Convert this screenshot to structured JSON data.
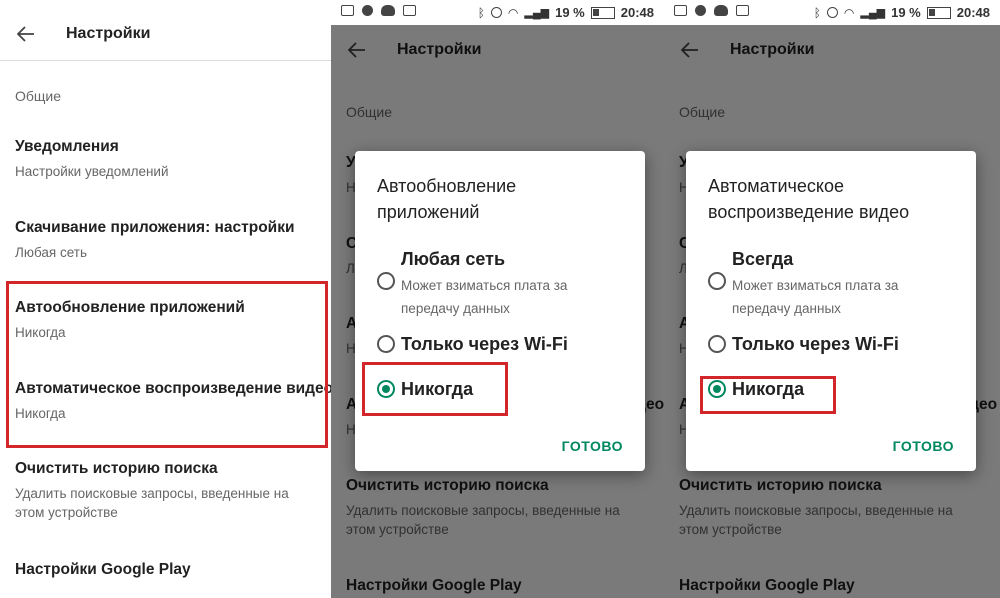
{
  "status_bar": {
    "battery": "19 %",
    "time": "20:48"
  },
  "appbar": {
    "title": "Настройки"
  },
  "settings": {
    "section": "Общие",
    "items": [
      {
        "title": "Уведомления",
        "subtitle": "Настройки уведомлений"
      },
      {
        "title": "Скачивание приложения: настройки",
        "subtitle": "Любая сеть"
      },
      {
        "title": "Автообновление приложений",
        "subtitle": "Никогда"
      },
      {
        "title": "Автоматическое воспроизведение видео",
        "subtitle": "Никогда"
      },
      {
        "title": "Очистить историю поиска",
        "subtitle": "Удалить поисковые запросы, введенные на этом устройстве"
      },
      {
        "title": "Настройки Google Play",
        "subtitle": ""
      }
    ]
  },
  "dialog_autoupdate": {
    "title": "Автообновление приложений",
    "options": [
      {
        "label": "Любая сеть",
        "note": "Может взиматься плата за передачу данных",
        "selected": false
      },
      {
        "label": "Только через Wi-Fi",
        "selected": false
      },
      {
        "label": "Никогда",
        "selected": true
      }
    ],
    "done": "ГОТОВО"
  },
  "dialog_autoplay": {
    "title": "Автоматическое воспроизведение видео",
    "options": [
      {
        "label": "Всегда",
        "note": "Может взиматься плата за передачу данных",
        "selected": false
      },
      {
        "label": "Только через Wi-Fi",
        "selected": false
      },
      {
        "label": "Никогда",
        "selected": true
      }
    ],
    "done": "ГОТОВО"
  },
  "colors": {
    "accent": "#00875f",
    "highlight": "#d3262b"
  }
}
